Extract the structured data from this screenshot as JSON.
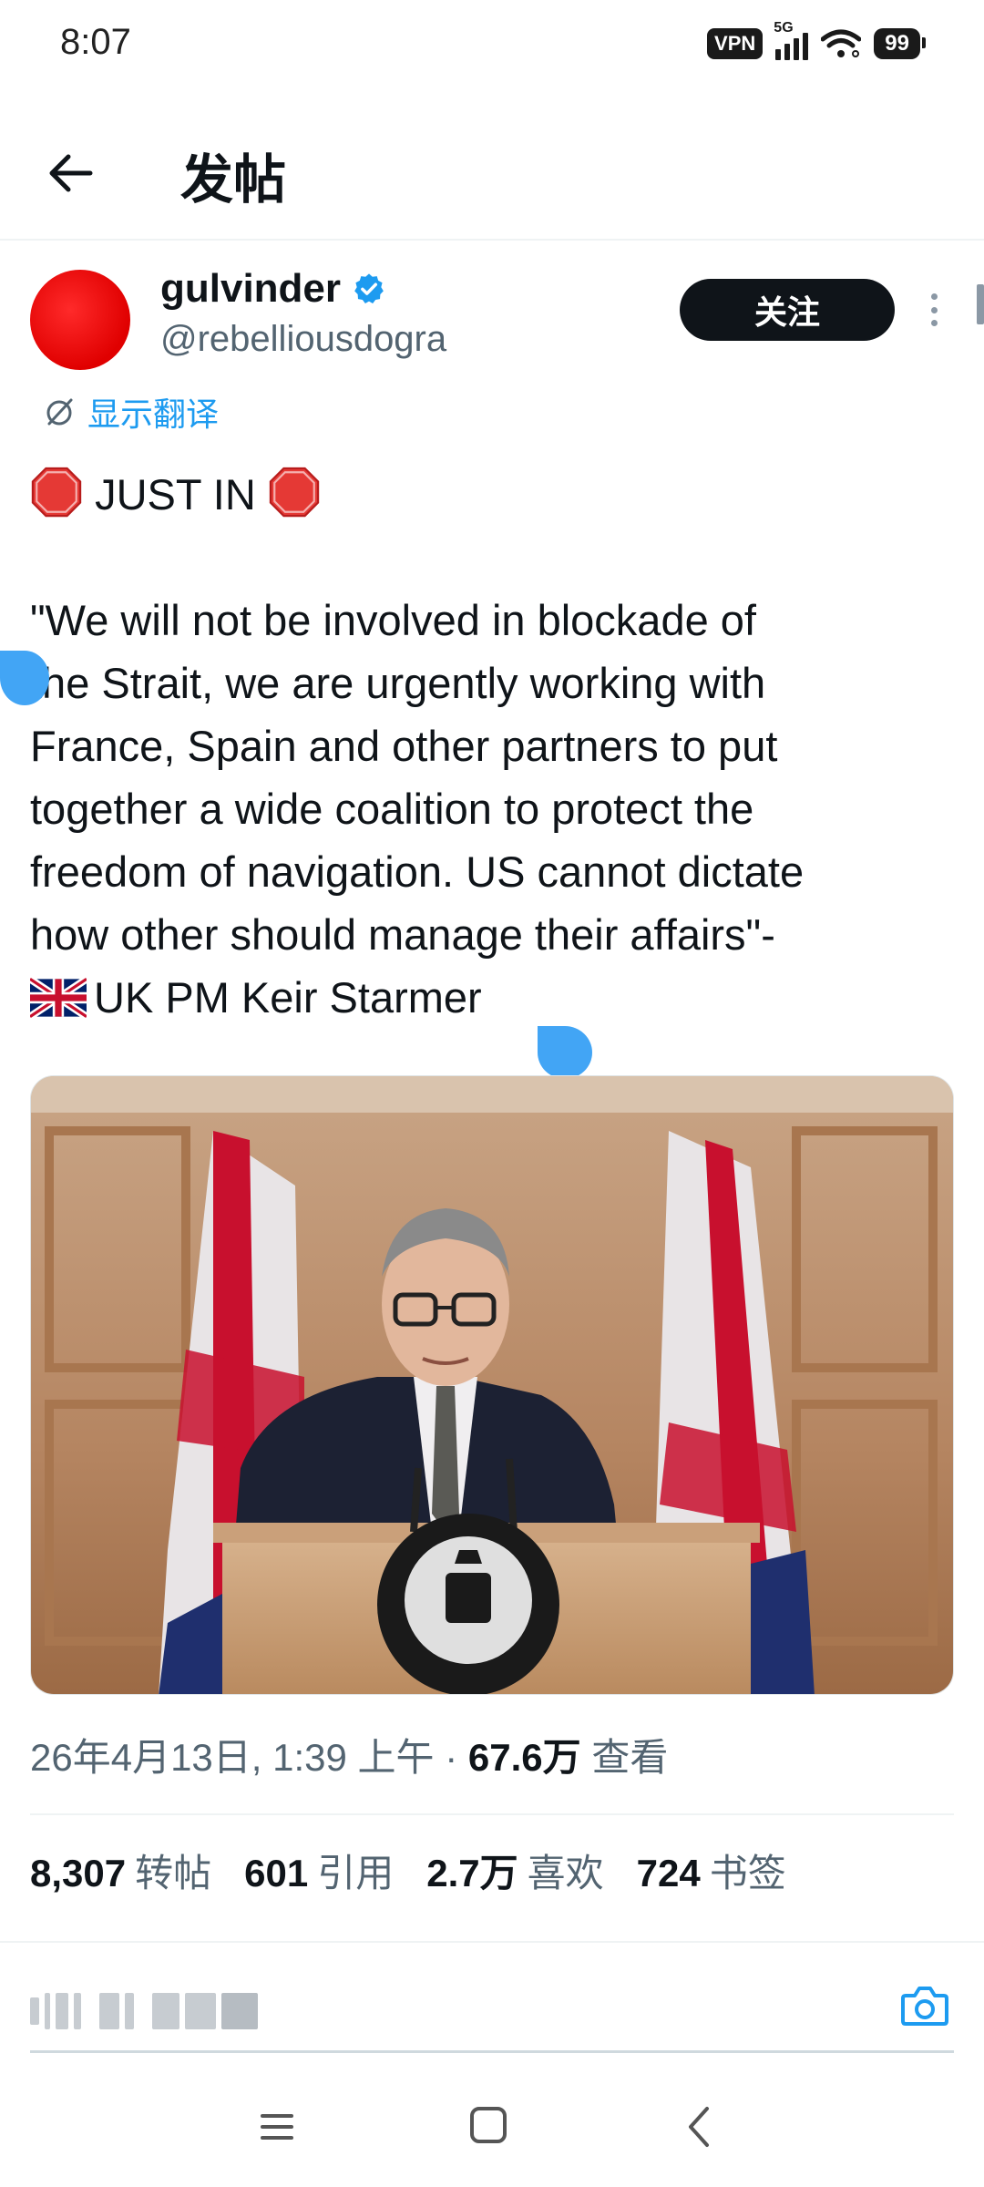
{
  "status_bar": {
    "time": "8:07",
    "vpn": "VPN",
    "network": "5G",
    "battery": "99"
  },
  "header": {
    "title": "发帖",
    "back_icon": "arrow-left-icon"
  },
  "post": {
    "display_name": "gulvinder",
    "handle": "@rebelliousdogra",
    "follow_label": "关注",
    "translate_label": "显示翻译",
    "text_lines": [
      "JUST IN",
      "\"We will not be involved in blockade of",
      "the Strait, we are urgently working with",
      "France, Spain and other partners to put",
      "together a wide coalition to protect the",
      "freedom of navigation. US cannot dictate",
      "how other should manage their affairs\"-",
      "UK PM Keir Starmer"
    ],
    "timestamp": "26年4月13日, 1:39 上午",
    "separator": "·",
    "views_count": "67.6万",
    "views_label": "查看",
    "avatar_color": "#e00000",
    "verified_color": "#1d9bf0"
  },
  "stats": {
    "reposts_count": "8,307",
    "reposts_label": "转帖",
    "quotes_count": "601",
    "quotes_label": "引用",
    "likes_count": "2.7万",
    "likes_label": "喜欢",
    "bookmarks_count": "724",
    "bookmarks_label": "书签"
  },
  "reply": {
    "camera_icon": "camera-icon"
  },
  "nav": {
    "menu_icon": "menu-icon",
    "home_icon": "home-square-icon",
    "back_icon": "chevron-left-icon"
  }
}
